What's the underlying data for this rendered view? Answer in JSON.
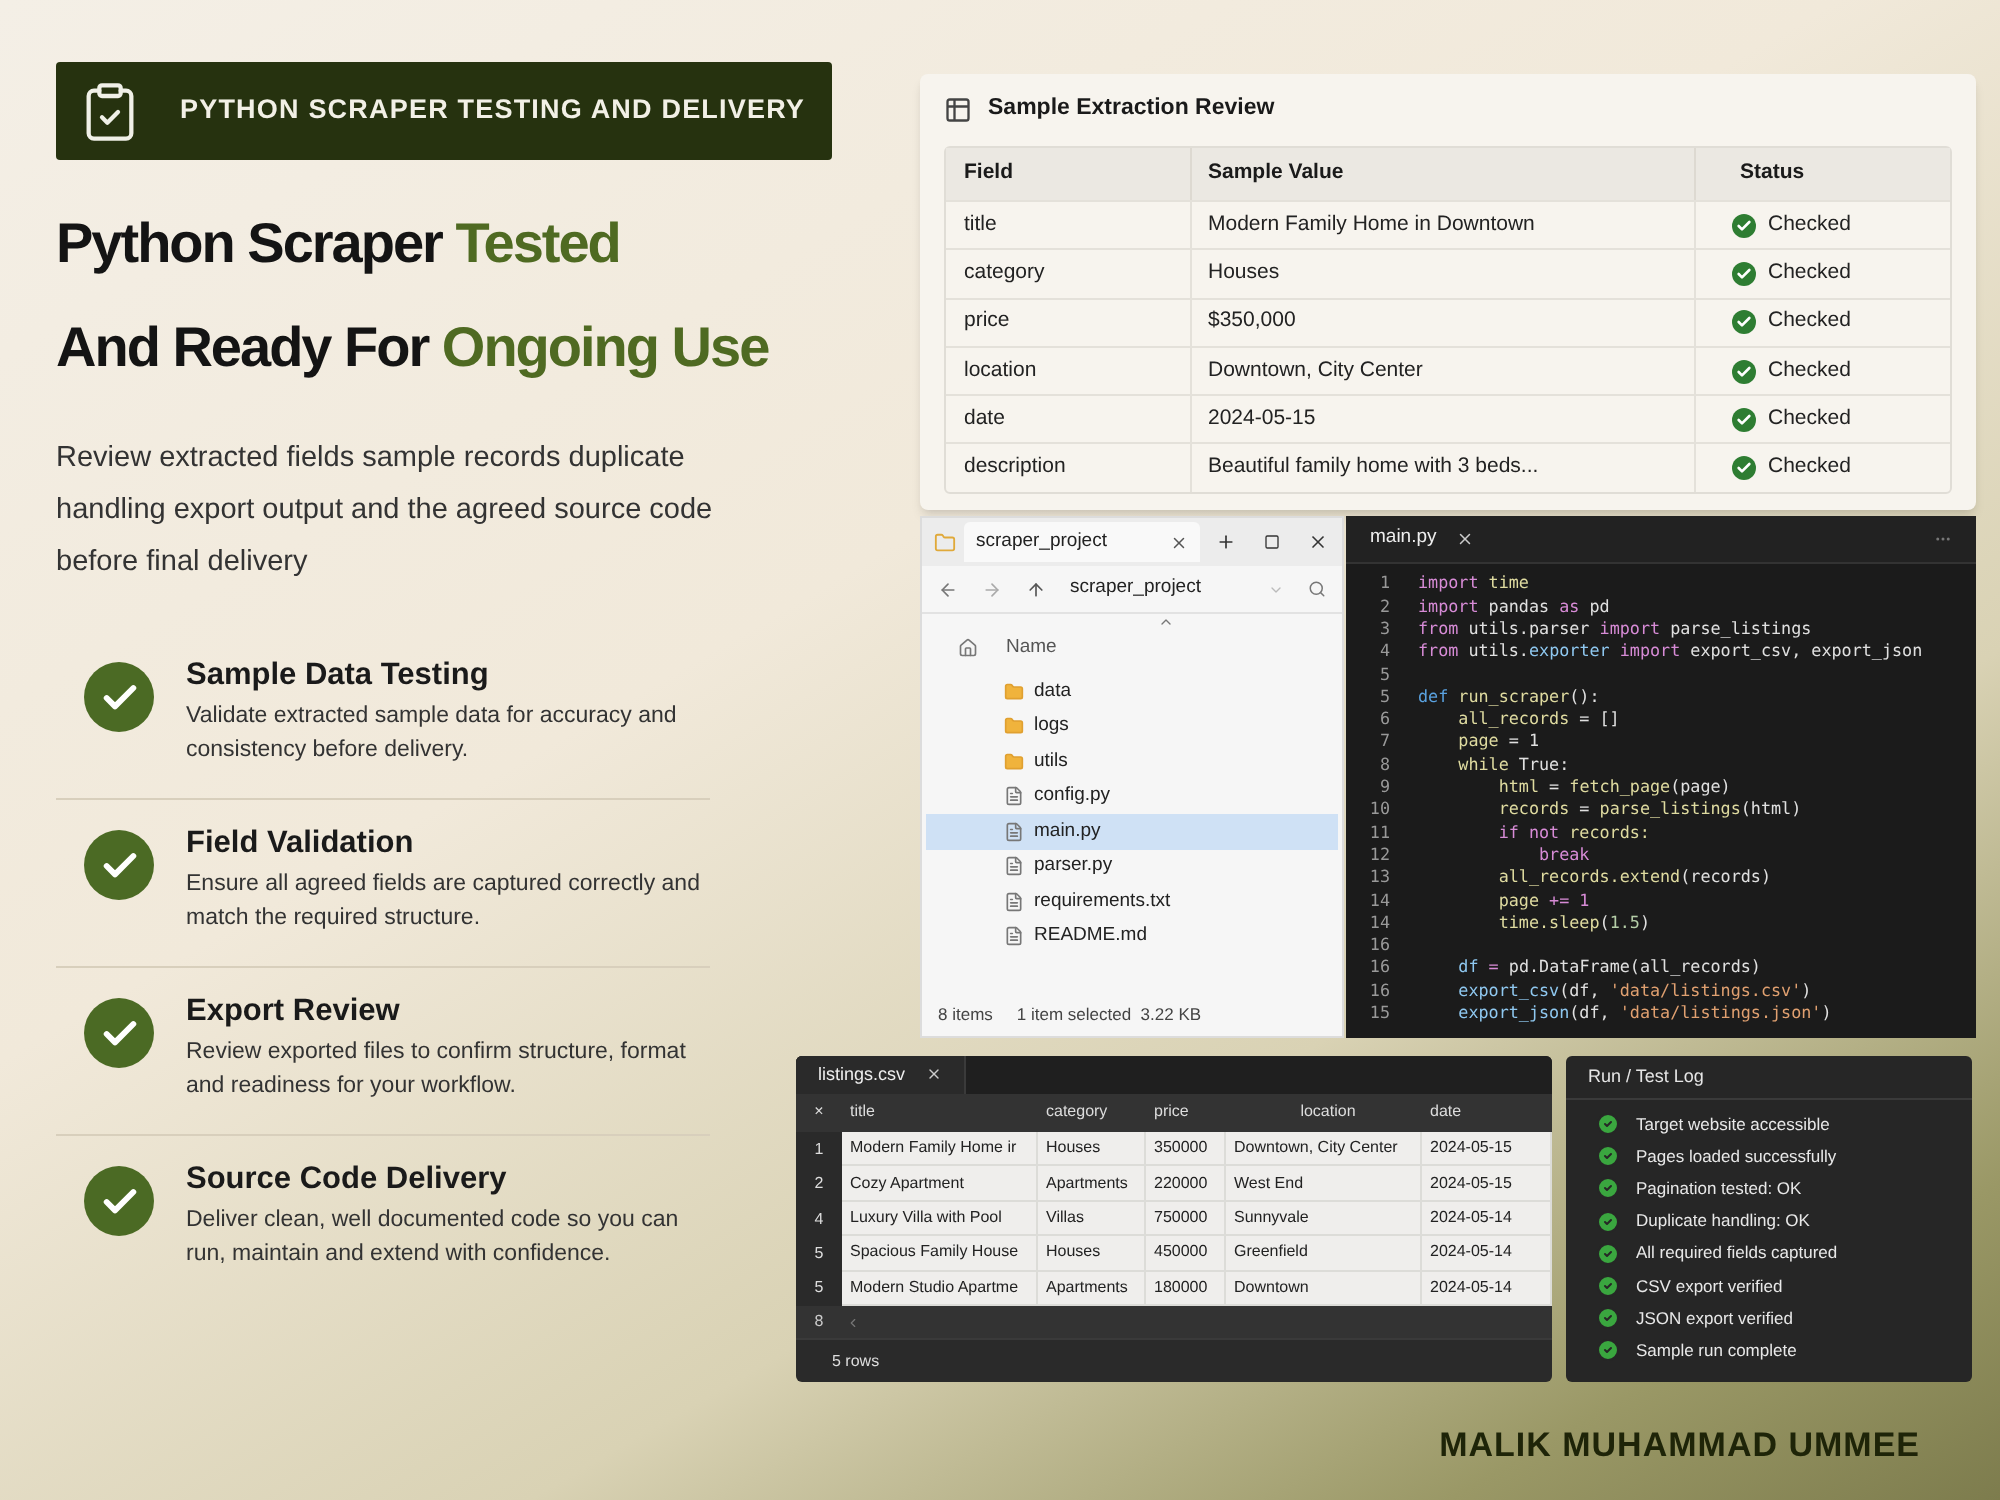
{
  "banner": {
    "title": "PYTHON SCRAPER TESTING AND DELIVERY"
  },
  "headline": [
    [
      {
        "text": "Python Scraper ",
        "accent": false
      },
      {
        "text": "Tested",
        "accent": true
      }
    ],
    [
      {
        "text": "And Ready For ",
        "accent": false
      },
      {
        "text": "Ongoing Use",
        "accent": true
      }
    ]
  ],
  "intro": "Review extracted fields sample records duplicate handling export output and the agreed source code before final delivery",
  "features": [
    {
      "title": "Sample Data Testing",
      "text": "Validate extracted sample data for accuracy and consistency before delivery.",
      "done": true
    },
    {
      "title": "Field Validation",
      "text": "Ensure all agreed fields are captured correctly and match the required structure.",
      "done": true
    },
    {
      "title": "Export Review",
      "text": "Review exported files to confirm structure, format and readiness for your workflow.",
      "done": true
    },
    {
      "title": "Source Code Delivery",
      "text": "Deliver clean, well documented code so you can run, maintain and extend with confidence.",
      "done": true
    }
  ],
  "review": {
    "title": "Sample Extraction Review",
    "columns": [
      "Field",
      "Sample Value",
      "Status"
    ],
    "rows": [
      {
        "field": "title",
        "value": "Modern Family Home in Downtown",
        "status": "Checked",
        "checked": true
      },
      {
        "field": "category",
        "value": "Houses",
        "status": "Checked",
        "checked": true
      },
      {
        "field": "price",
        "value": "$350,000",
        "status": "Checked",
        "checked": true
      },
      {
        "field": "location",
        "value": "Downtown, City Center",
        "status": "Checked",
        "checked": true
      },
      {
        "field": "date",
        "value": "2024-05-15",
        "status": "Checked",
        "checked": true
      },
      {
        "field": "description",
        "value": "Beautiful family home with 3 beds...",
        "status": "Checked",
        "checked": true
      }
    ]
  },
  "explorer": {
    "tab": "scraper_project",
    "path": "scraper_project",
    "column": "Name",
    "items": [
      {
        "name": "data",
        "kind": "folder",
        "selected": false
      },
      {
        "name": "logs",
        "kind": "folder",
        "selected": false
      },
      {
        "name": "utils",
        "kind": "folder",
        "selected": false
      },
      {
        "name": "config.py",
        "kind": "file",
        "selected": false
      },
      {
        "name": "main.py",
        "kind": "file",
        "selected": true
      },
      {
        "name": "parser.py",
        "kind": "file",
        "selected": false
      },
      {
        "name": "requirements.txt",
        "kind": "file",
        "selected": false
      },
      {
        "name": "README.md",
        "kind": "file",
        "selected": false
      }
    ],
    "status_count": "8 items",
    "status_selection": "1 item selected  3.22 KB"
  },
  "editor": {
    "tab": "main.py",
    "lines": [
      {
        "number": "1",
        "tokens": [
          {
            "text": "import ",
            "kind": "kw"
          },
          {
            "text": "time",
            "kind": "fn"
          }
        ]
      },
      {
        "number": "2",
        "tokens": [
          {
            "text": "import ",
            "kind": "kw"
          },
          {
            "text": "pandas ",
            "kind": "plain"
          },
          {
            "text": "as ",
            "kind": "kw"
          },
          {
            "text": "pd",
            "kind": "plain"
          }
        ]
      },
      {
        "number": "3",
        "tokens": [
          {
            "text": "from ",
            "kind": "kw"
          },
          {
            "text": "utils.parser ",
            "kind": "plain"
          },
          {
            "text": "import ",
            "kind": "kw"
          },
          {
            "text": "parse_listings",
            "kind": "plain"
          }
        ]
      },
      {
        "number": "4",
        "tokens": [
          {
            "text": "from ",
            "kind": "kw"
          },
          {
            "text": "utils.",
            "kind": "plain"
          },
          {
            "text": "exporter ",
            "kind": "var"
          },
          {
            "text": "import ",
            "kind": "kw"
          },
          {
            "text": "export_csv, export_json",
            "kind": "plain"
          }
        ]
      },
      {
        "number": "5"
      },
      {
        "number": "5",
        "tokens": [
          {
            "text": "def ",
            "kind": "def"
          },
          {
            "text": "run_scraper",
            "kind": "fn"
          },
          {
            "text": "():",
            "kind": "plain"
          }
        ]
      },
      {
        "number": "6",
        "tokens": [
          {
            "text": "    all_records",
            "kind": "fn"
          },
          {
            "text": " = []",
            "kind": "plain"
          }
        ]
      },
      {
        "number": "7",
        "tokens": [
          {
            "text": "    page",
            "kind": "fn"
          },
          {
            "text": " = 1",
            "kind": "plain"
          }
        ]
      },
      {
        "number": "8",
        "tokens": [
          {
            "text": "    while ",
            "kind": "fn"
          },
          {
            "text": "True:",
            "kind": "plain"
          }
        ]
      },
      {
        "number": "9",
        "tokens": [
          {
            "text": "        html",
            "kind": "fn"
          },
          {
            "text": " = ",
            "kind": "plain"
          },
          {
            "text": "fetch_page",
            "kind": "fn"
          },
          {
            "text": "(page)",
            "kind": "plain"
          }
        ]
      },
      {
        "number": "10",
        "tokens": [
          {
            "text": "        records",
            "kind": "fn"
          },
          {
            "text": " = ",
            "kind": "plain"
          },
          {
            "text": "parse_listings",
            "kind": "fn"
          },
          {
            "text": "(html)",
            "kind": "plain"
          }
        ]
      },
      {
        "number": "11",
        "tokens": [
          {
            "text": "        if not ",
            "kind": "kw"
          },
          {
            "text": "records:",
            "kind": "fn"
          }
        ]
      },
      {
        "number": "12",
        "tokens": [
          {
            "text": "            break",
            "kind": "kw"
          }
        ]
      },
      {
        "number": "13",
        "tokens": [
          {
            "text": "        all_records.extend",
            "kind": "fn"
          },
          {
            "text": "(records)",
            "kind": "plain"
          }
        ]
      },
      {
        "number": "14",
        "tokens": [
          {
            "text": "        page",
            "kind": "fn"
          },
          {
            "text": " += 1",
            "kind": "kw"
          }
        ]
      },
      {
        "number": "14",
        "tokens": [
          {
            "text": "        time.sleep",
            "kind": "fn"
          },
          {
            "text": "(",
            "kind": "plain"
          },
          {
            "text": "1.5",
            "kind": "num"
          },
          {
            "text": ")",
            "kind": "plain"
          }
        ]
      },
      {
        "number": "16"
      },
      {
        "number": "16",
        "tokens": [
          {
            "text": "    df",
            "kind": "var"
          },
          {
            "text": " = ",
            "kind": "kw"
          },
          {
            "text": "pd.DataFrame(all_records)",
            "kind": "plain"
          }
        ]
      },
      {
        "number": "16",
        "tokens": [
          {
            "text": "    export_csv",
            "kind": "var"
          },
          {
            "text": "(df, ",
            "kind": "plain"
          },
          {
            "text": "'data/listings.csv'",
            "kind": "str"
          },
          {
            "text": ")",
            "kind": "plain"
          }
        ]
      },
      {
        "number": "15",
        "tokens": [
          {
            "text": "    export_json",
            "kind": "var"
          },
          {
            "text": "(df, ",
            "kind": "plain"
          },
          {
            "text": "'data/listings.json'",
            "kind": "str"
          },
          {
            "text": ")",
            "kind": "plain"
          }
        ]
      }
    ]
  },
  "sheet": {
    "tab": "listings.csv",
    "corner": "×",
    "columns": [
      "title",
      "category",
      "price",
      "location",
      "date"
    ],
    "rows": [
      {
        "number": "1",
        "cells": [
          "Modern Family Home ir",
          "Houses",
          "350000",
          "Downtown, City Center",
          "2024-05-15"
        ]
      },
      {
        "number": "2",
        "cells": [
          "Cozy Apartment",
          "Apartments",
          "220000",
          "West End",
          "2024-05-15"
        ]
      },
      {
        "number": "4",
        "cells": [
          "Luxury Villa with Pool",
          "Villas",
          "750000",
          "Sunnyvale",
          "2024-05-14"
        ]
      },
      {
        "number": "5",
        "cells": [
          "Spacious Family House",
          "Houses",
          "450000",
          "Greenfield",
          "2024-05-14"
        ]
      },
      {
        "number": "5",
        "cells": [
          "Modern Studio Apartme",
          "Apartments",
          "180000",
          "Downtown",
          "2024-05-14"
        ]
      }
    ],
    "empty_row_number": "8",
    "footer": "5 rows"
  },
  "log": {
    "title": "Run / Test Log",
    "items": [
      {
        "text": "Target website accessible",
        "passed": true
      },
      {
        "text": "Pages loaded successfully",
        "passed": true
      },
      {
        "text": "Pagination tested: OK",
        "passed": true
      },
      {
        "text": "Duplicate handling: OK",
        "passed": true
      },
      {
        "text": "All required fields captured",
        "passed": true
      },
      {
        "text": "CSV export verified",
        "passed": true
      },
      {
        "text": "JSON export verified",
        "passed": true
      },
      {
        "text": "Sample run complete",
        "passed": true
      }
    ]
  },
  "author": "MALIK MUHAMMAD UMMEE"
}
